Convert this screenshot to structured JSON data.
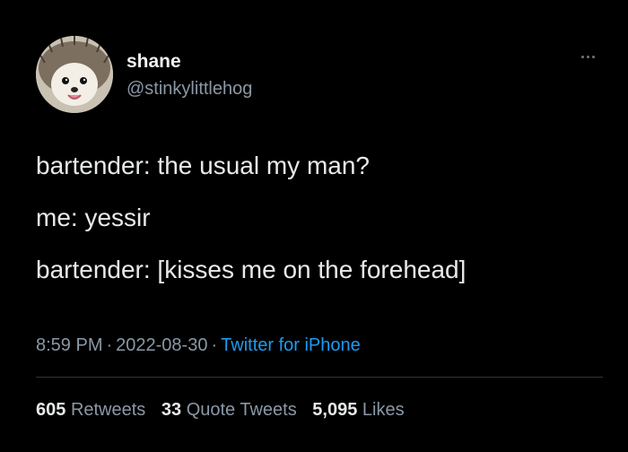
{
  "tweet": {
    "author": {
      "display_name": "shane",
      "handle": "@stinkylittlehog",
      "avatar_icon": "hedgehog-avatar"
    },
    "more_icon": "ellipsis-icon",
    "text_lines": [
      "bartender: the usual my man?",
      "me: yessir",
      "bartender: [kisses me on the forehead]"
    ],
    "time": "8:59 PM",
    "date": "2022-08-30",
    "separator": "·",
    "source": "Twitter for iPhone",
    "stats": {
      "retweets_count": "605",
      "retweets_label": "Retweets",
      "quote_tweets_count": "33",
      "quote_tweets_label": "Quote Tweets",
      "likes_count": "5,095",
      "likes_label": "Likes"
    }
  },
  "colors": {
    "background": "#000000",
    "text": "#e7e9ea",
    "muted": "#8b98a5",
    "link": "#1d9bf0",
    "divider": "#2f3336"
  }
}
